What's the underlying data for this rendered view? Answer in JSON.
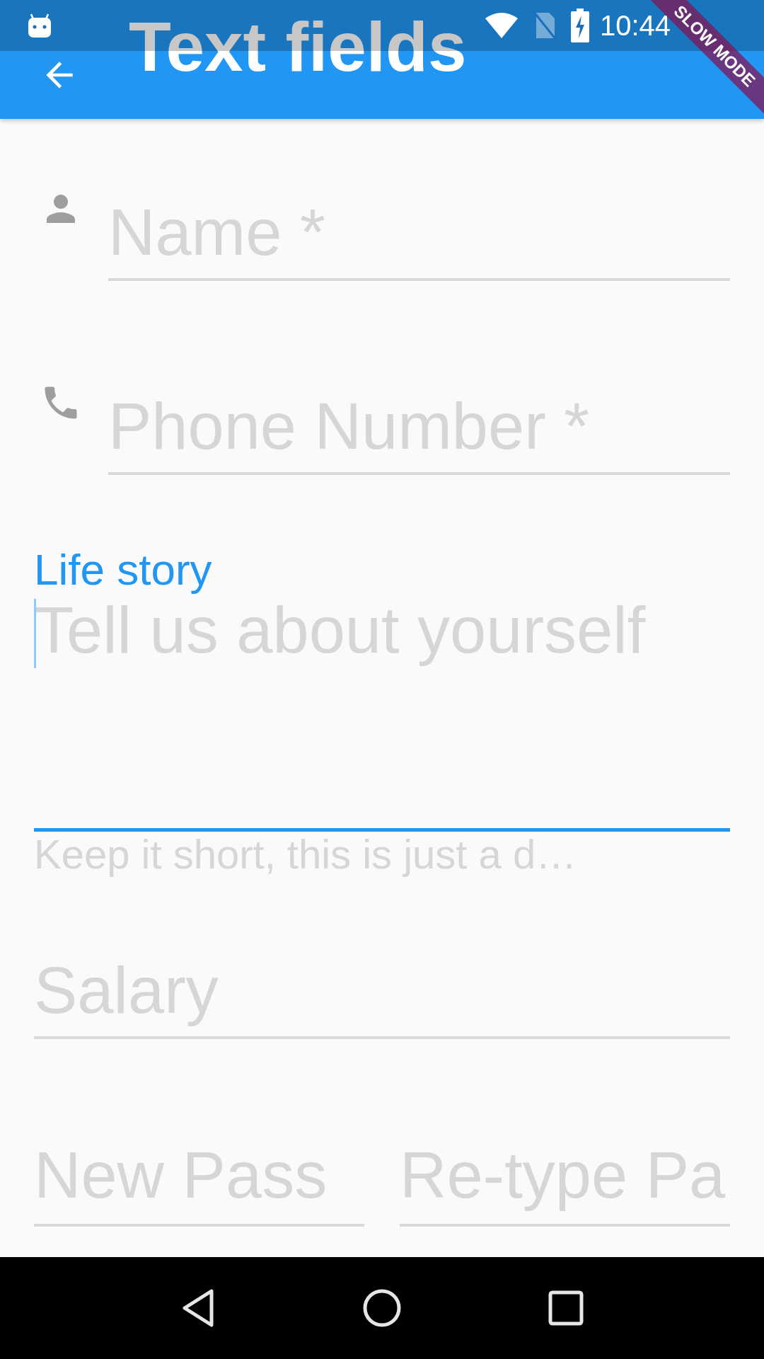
{
  "status_bar": {
    "time": "10:44"
  },
  "debug_banner": {
    "text": "SLOW MODE"
  },
  "app_bar": {
    "title": "Text fields"
  },
  "fields": [
    {
      "kind": "name",
      "placeholder": "Name *",
      "focused": false
    },
    {
      "kind": "phone",
      "placeholder": "Phone Number *",
      "focused": false
    },
    {
      "kind": "multiline",
      "label": "Life story",
      "placeholder": "Tell us about yourself",
      "helper": "Keep it short, this is just a d…",
      "focused": true
    },
    {
      "kind": "plain",
      "placeholder": "Salary",
      "focused": false
    }
  ],
  "password_fields": [
    {
      "placeholder": "New Pass",
      "focused": false
    },
    {
      "placeholder": "Re-type Pa",
      "focused": false
    }
  ]
}
